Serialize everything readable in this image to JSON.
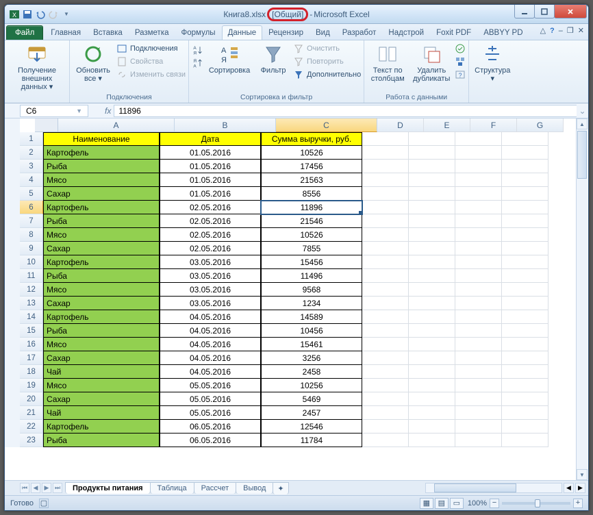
{
  "title": {
    "file": "Книга8.xlsx",
    "shared": "[Общий]",
    "dash": " - ",
    "app": "Microsoft Excel"
  },
  "tabs": {
    "file": "Файл",
    "t0": "Главная",
    "t1": "Вставка",
    "t2": "Разметка",
    "t3": "Формулы",
    "t4": "Данные",
    "t5": "Рецензир",
    "t6": "Вид",
    "t7": "Разработ",
    "t8": "Надстрой",
    "t9": "Foxit PDF",
    "t10": "ABBYY PD"
  },
  "ribbon": {
    "g1": {
      "big1": "Получение\nвнешних данных ▾",
      "label": ""
    },
    "g2": {
      "big": "Обновить\nвсе ▾",
      "s1": "Подключения",
      "s2": "Свойства",
      "s3": "Изменить связи",
      "label": "Подключения"
    },
    "g3": {
      "big": "Сортировка",
      "bigR": "Фильтр",
      "s1": "Очистить",
      "s2": "Повторить",
      "s3": "Дополнительно",
      "label": "Сортировка и фильтр"
    },
    "g4": {
      "big1": "Текст по\nстолбцам",
      "big2": "Удалить\nдубликаты",
      "label": "Работа с данными"
    },
    "g5": {
      "big": "Структура\n▾",
      "label": ""
    }
  },
  "formula": {
    "name": "C6",
    "value": "11896"
  },
  "cols": [
    "A",
    "B",
    "C",
    "D",
    "E",
    "F",
    "G"
  ],
  "headers": {
    "a": "Наименование",
    "b": "Дата",
    "c": "Сумма выручки, руб."
  },
  "rows": [
    {
      "n": 2,
      "a": "Картофель",
      "b": "01.05.2016",
      "c": "10526"
    },
    {
      "n": 3,
      "a": "Рыба",
      "b": "01.05.2016",
      "c": "17456"
    },
    {
      "n": 4,
      "a": "Мясо",
      "b": "01.05.2016",
      "c": "21563"
    },
    {
      "n": 5,
      "a": "Сахар",
      "b": "01.05.2016",
      "c": "8556"
    },
    {
      "n": 6,
      "a": "Картофель",
      "b": "02.05.2016",
      "c": "11896"
    },
    {
      "n": 7,
      "a": "Рыба",
      "b": "02.05.2016",
      "c": "21546"
    },
    {
      "n": 8,
      "a": "Мясо",
      "b": "02.05.2016",
      "c": "10526"
    },
    {
      "n": 9,
      "a": "Сахар",
      "b": "02.05.2016",
      "c": "7855"
    },
    {
      "n": 10,
      "a": "Картофель",
      "b": "03.05.2016",
      "c": "15456"
    },
    {
      "n": 11,
      "a": "Рыба",
      "b": "03.05.2016",
      "c": "11496"
    },
    {
      "n": 12,
      "a": "Мясо",
      "b": "03.05.2016",
      "c": "9568"
    },
    {
      "n": 13,
      "a": "Сахар",
      "b": "03.05.2016",
      "c": "1234"
    },
    {
      "n": 14,
      "a": "Картофель",
      "b": "04.05.2016",
      "c": "14589"
    },
    {
      "n": 15,
      "a": "Рыба",
      "b": "04.05.2016",
      "c": "10456"
    },
    {
      "n": 16,
      "a": "Мясо",
      "b": "04.05.2016",
      "c": "15461"
    },
    {
      "n": 17,
      "a": "Сахар",
      "b": "04.05.2016",
      "c": "3256"
    },
    {
      "n": 18,
      "a": "Чай",
      "b": "04.05.2016",
      "c": "2458"
    },
    {
      "n": 19,
      "a": "Мясо",
      "b": "05.05.2016",
      "c": "10256"
    },
    {
      "n": 20,
      "a": "Сахар",
      "b": "05.05.2016",
      "c": "5469"
    },
    {
      "n": 21,
      "a": "Чай",
      "b": "05.05.2016",
      "c": "2457"
    },
    {
      "n": 22,
      "a": "Картофель",
      "b": "06.05.2016",
      "c": "12546"
    },
    {
      "n": 23,
      "a": "Рыба",
      "b": "06.05.2016",
      "c": "11784"
    }
  ],
  "sheets": {
    "s1": "Продукты питания",
    "s2": "Таблица",
    "s3": "Рассчет",
    "s4": "Вывод"
  },
  "status": {
    "ready": "Готово",
    "zoom": "100%"
  }
}
